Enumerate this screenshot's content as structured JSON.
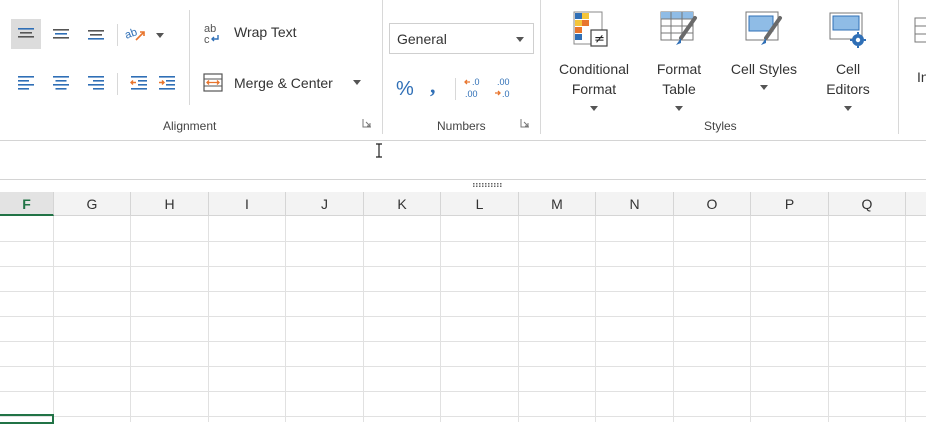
{
  "alignment": {
    "wrap_text_label": "Wrap Text",
    "merge_center_label": "Merge & Center",
    "group_label": "Alignment"
  },
  "numbers": {
    "format_value": "General",
    "group_label": "Numbers"
  },
  "styles": {
    "conditional_format": [
      "Conditional",
      "Format"
    ],
    "format_table": [
      "Format",
      "Table"
    ],
    "cell_styles": "Cell Styles",
    "cell_editors": [
      "Cell",
      "Editors"
    ],
    "group_label": "Styles"
  },
  "cells": {
    "insert_partial": "In"
  },
  "grid": {
    "active_column": "F",
    "columns": [
      "F",
      "G",
      "H",
      "I",
      "J",
      "K",
      "L",
      "M",
      "N",
      "O",
      "P",
      "Q"
    ]
  },
  "colors": {
    "accent_green": "#217346",
    "icon_blue": "#2f6fb6",
    "icon_orange": "#e8752d"
  }
}
